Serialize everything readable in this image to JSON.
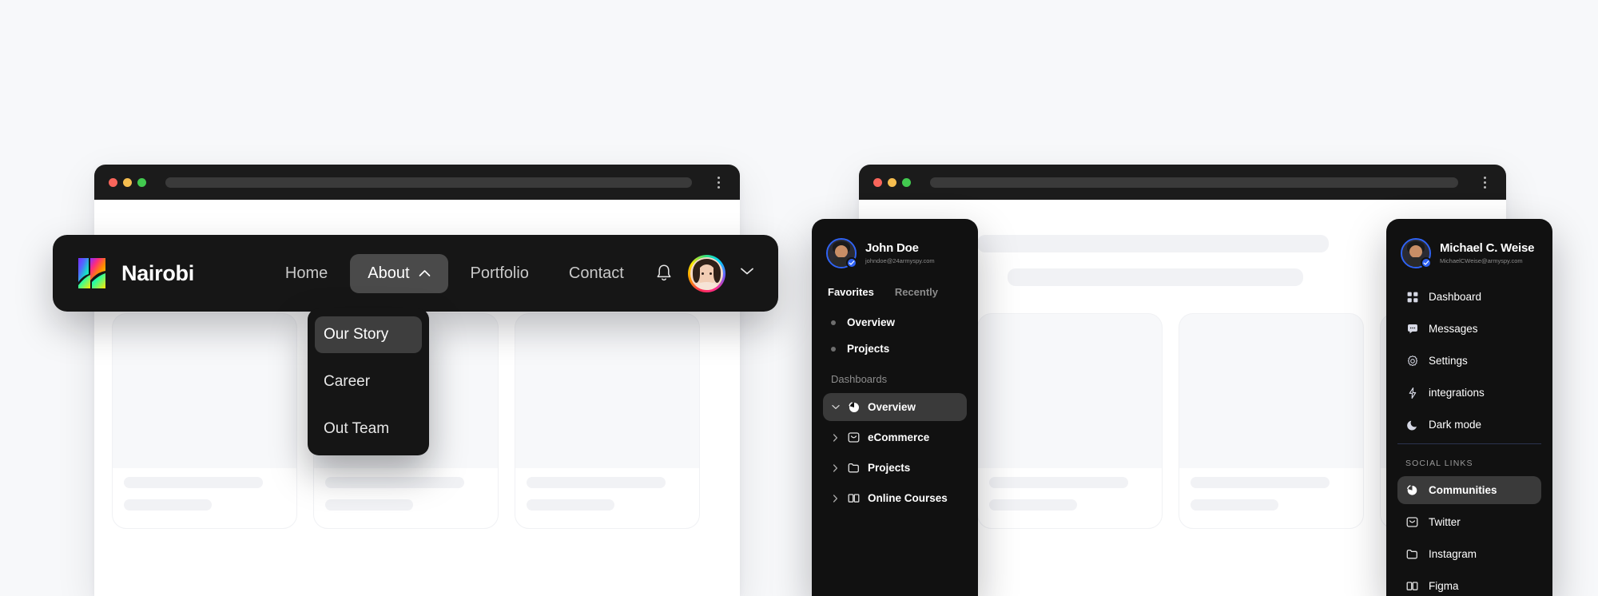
{
  "browser_left": {
    "window_controls": [
      "close",
      "minimize",
      "maximize"
    ],
    "url_value": "",
    "menu_icon": "kebab-menu-icon"
  },
  "browser_right": {
    "window_controls": [
      "close",
      "minimize",
      "maximize"
    ],
    "url_value": "",
    "menu_icon": "kebab-menu-icon"
  },
  "navbar": {
    "brand": "Nairobi",
    "logo_icon": "nairobi-gradient-n-logo",
    "links": [
      {
        "label": "Home",
        "active": false,
        "chevron": ""
      },
      {
        "label": "About",
        "active": true,
        "chevron": "chevron-up-icon"
      },
      {
        "label": "Portfolio",
        "active": false,
        "chevron": ""
      },
      {
        "label": "Contact",
        "active": false,
        "chevron": ""
      }
    ],
    "bell_icon": "notification-bell-icon",
    "avatar_icon": "user-avatar",
    "chevron_icon": "chevron-down-icon"
  },
  "dropdown": {
    "items": [
      {
        "label": "Our Story",
        "active": true
      },
      {
        "label": "Career",
        "active": false
      },
      {
        "label": "Out Team",
        "active": false
      }
    ]
  },
  "panel_mid": {
    "profile": {
      "name": "John Doe",
      "email": "johndoe@24armyspy.com",
      "avatar_icon": "user-avatar",
      "badge_icon": "verified-badge-icon"
    },
    "tabs": [
      {
        "label": "Favorites",
        "active": true
      },
      {
        "label": "Recently",
        "active": false
      }
    ],
    "favorites": [
      {
        "label": "Overview"
      },
      {
        "label": "Projects"
      }
    ],
    "section_title": "Dashboards",
    "dashboards": [
      {
        "label": "Overview",
        "icon": "pie-chart-icon",
        "chevron": "chevron-down-icon",
        "active": true
      },
      {
        "label": "eCommerce",
        "icon": "inbox-icon",
        "chevron": "chevron-right-icon",
        "active": false
      },
      {
        "label": "Projects",
        "icon": "folder-icon",
        "chevron": "chevron-right-icon",
        "active": false
      },
      {
        "label": "Online Courses",
        "icon": "book-open-icon",
        "chevron": "chevron-right-icon",
        "active": false
      }
    ]
  },
  "panel_right": {
    "profile": {
      "name": "Michael C. Weise",
      "email": "MichaelCWeise@armyspy.com",
      "avatar_icon": "user-avatar",
      "badge_icon": "verified-badge-icon"
    },
    "menu": [
      {
        "label": "Dashboard",
        "icon": "grid-icon",
        "active": false
      },
      {
        "label": "Messages",
        "icon": "chat-icon",
        "active": false
      },
      {
        "label": "Settings",
        "icon": "gear-icon",
        "active": false
      },
      {
        "label": "integrations",
        "icon": "zap-icon",
        "active": false
      },
      {
        "label": "Dark mode",
        "icon": "moon-icon",
        "active": false
      }
    ],
    "section_title": "SOCIAL LINKS",
    "social": [
      {
        "label": "Communities",
        "icon": "pie-chart-icon",
        "active": true
      },
      {
        "label": "Twitter",
        "icon": "inbox-icon",
        "active": false
      },
      {
        "label": "Instagram",
        "icon": "folder-icon",
        "active": false
      },
      {
        "label": "Figma",
        "icon": "book-open-icon",
        "active": false
      }
    ]
  },
  "colors": {
    "page_bg": "#f7f8fa",
    "chrome_bg": "#1b1b1b",
    "panel_bg": "#111111",
    "navbar_bg": "#161616",
    "dropdown_bg": "#151515",
    "active_pill": "#3a3a3a",
    "accent_blue": "#2f63f5",
    "skeleton": "#f1f2f5",
    "dot_red": "#f9655b",
    "dot_yellow": "#f5bd4f",
    "dot_green": "#42c94f"
  }
}
